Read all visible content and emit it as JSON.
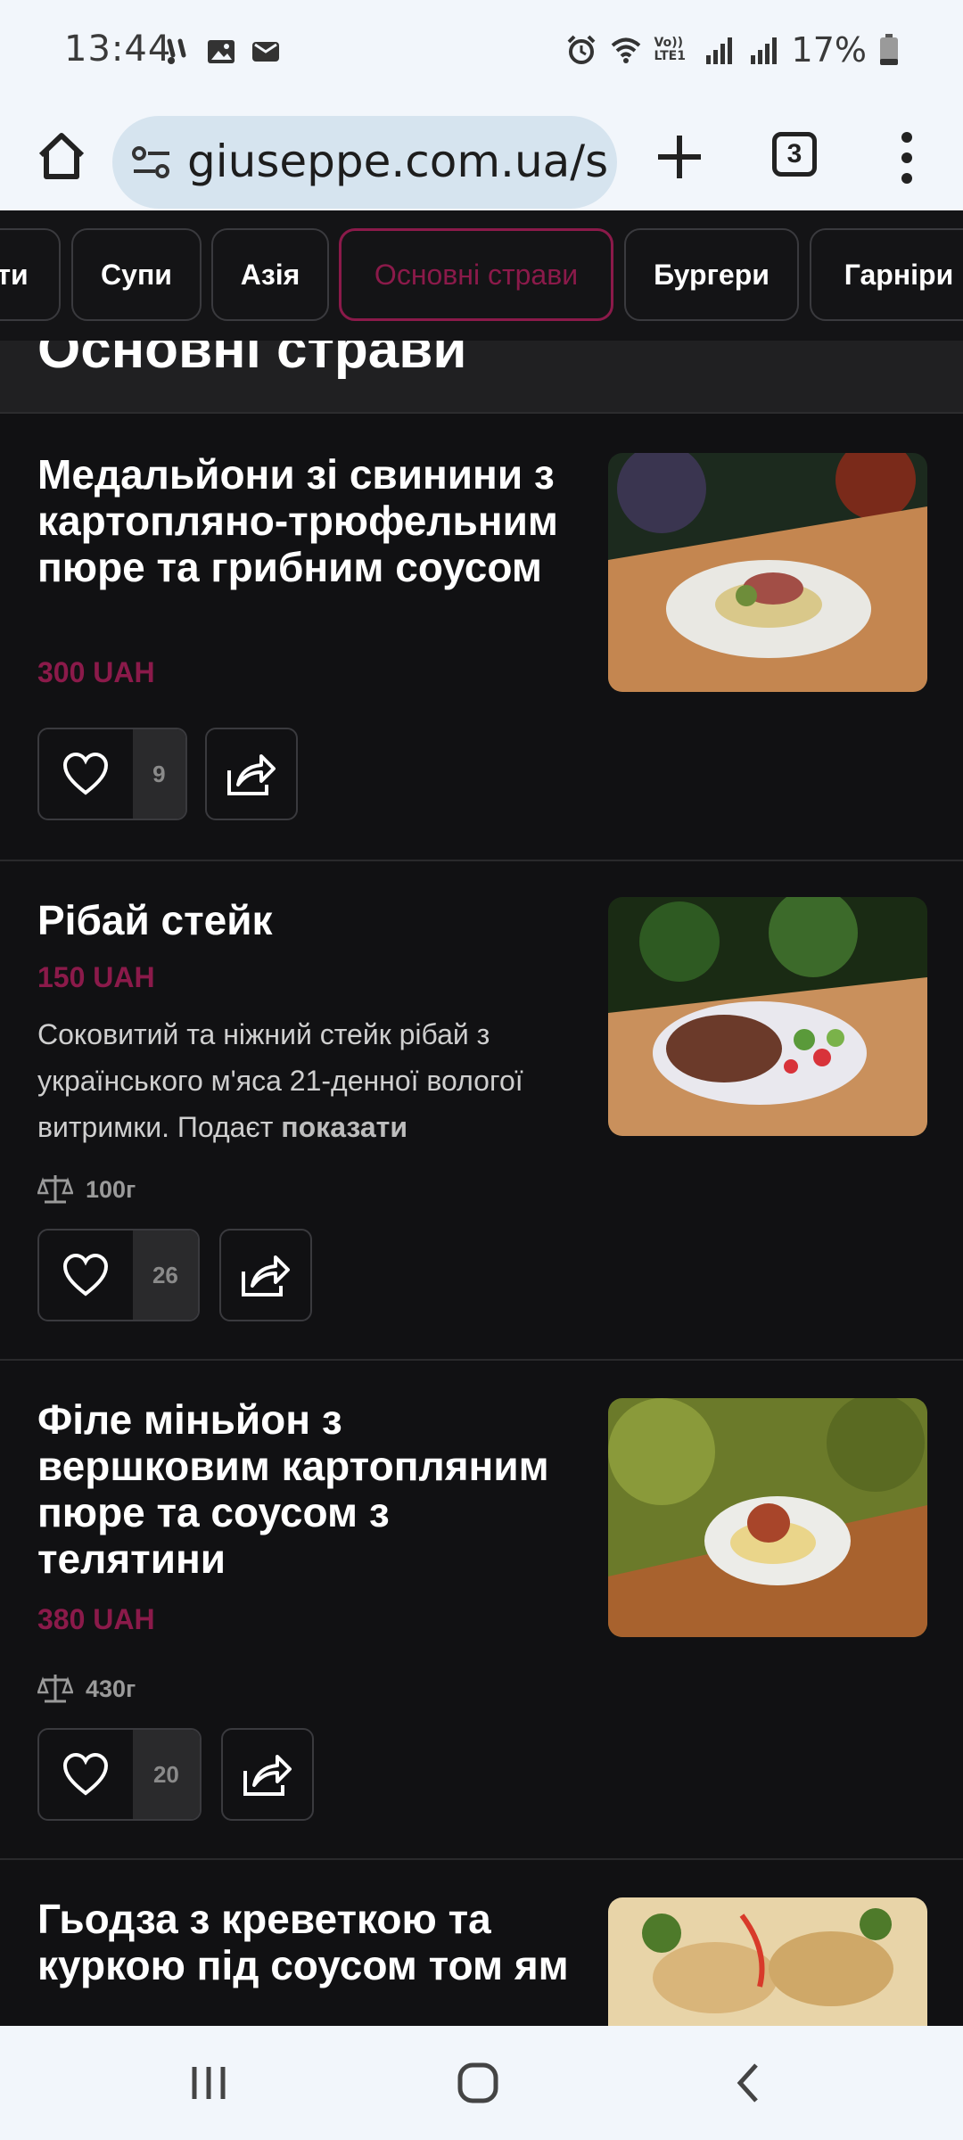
{
  "status": {
    "time": "13:44",
    "battery": "17%",
    "left_icons": [
      "voicemail-icon",
      "image-icon",
      "message-icon"
    ],
    "right_icons": [
      "alarm-icon",
      "wifi-icon",
      "volte-icon",
      "signal-icon",
      "signal-icon",
      "battery-icon"
    ],
    "volte_label": "Vo)) LTE1"
  },
  "browser": {
    "url": "giuseppe.com.ua/s",
    "tab_count": "3"
  },
  "categories": [
    {
      "label": "ти",
      "active": false
    },
    {
      "label": "Супи",
      "active": false
    },
    {
      "label": "Азія",
      "active": false
    },
    {
      "label": "Основні страви",
      "active": true
    },
    {
      "label": "Бургери",
      "active": false
    },
    {
      "label": "Гарніри",
      "active": false
    }
  ],
  "section": {
    "title": "Основні страви"
  },
  "dishes": [
    {
      "title": "Медальйони зі свинини з картопляно-трюфельним пюре та грибним соусом",
      "price": "300 UAH",
      "likes": "9"
    },
    {
      "title": "Рібай стейк",
      "price": "150 UAH",
      "description": "Соковитий та ніжний стейк рібай з українського м'яса 21-денної вологої витримки. Подаєт",
      "show_more": "показати",
      "weight": "100г",
      "likes": "26"
    },
    {
      "title": "Філе міньйон з вершковим картопляним пюре та соусом з телятини",
      "price": "380 UAH",
      "weight": "430г",
      "likes": "20"
    },
    {
      "title": "Гьодза з креветкою та куркою під соусом том ям"
    }
  ],
  "colors": {
    "accent": "#8b1a4a",
    "background": "#111113",
    "status_bar": "#f2f6fb"
  }
}
